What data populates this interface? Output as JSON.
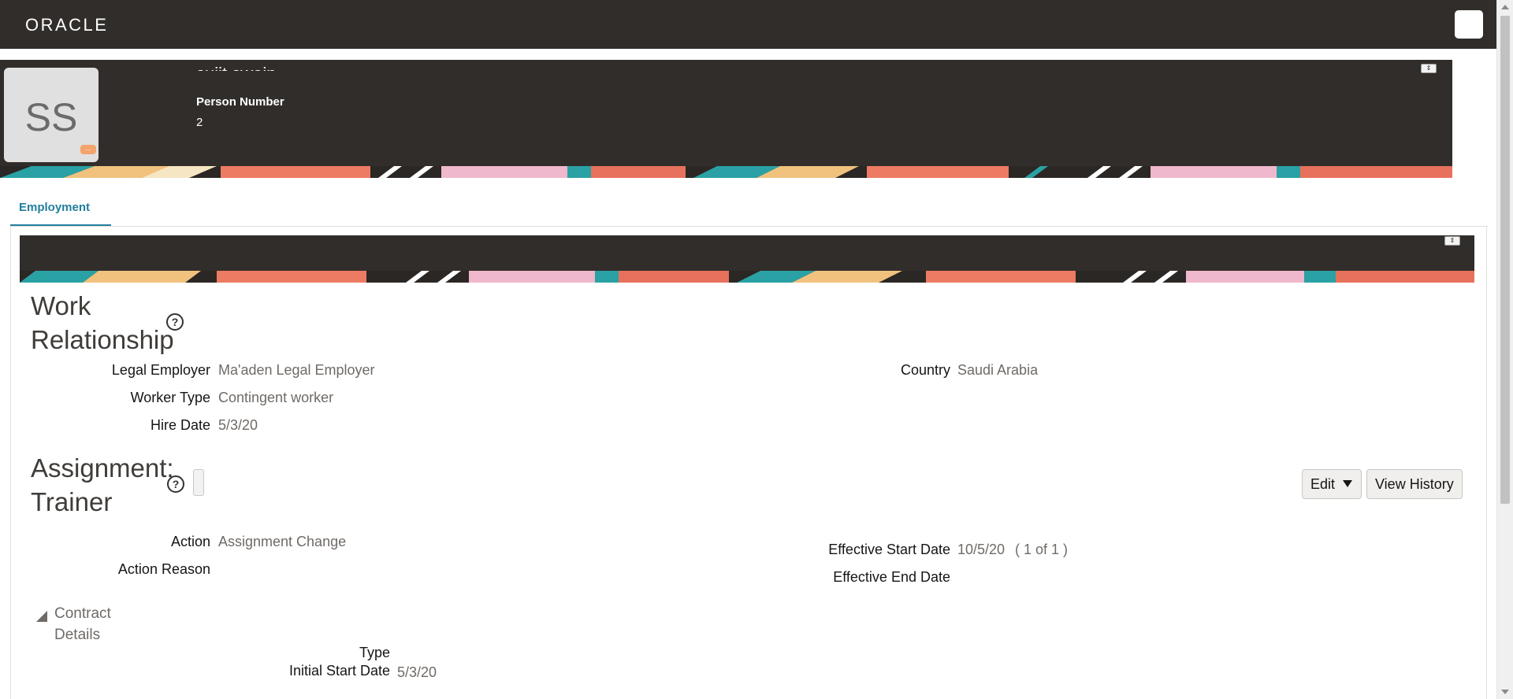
{
  "topbar": {
    "logo": "ORACLE",
    "user_icon": "user-menu-icon"
  },
  "header": {
    "avatar_initials": "SS",
    "avatar_badge": "...",
    "person_name": "sujit swain",
    "person_number_label": "Person Number",
    "person_number_value": "2",
    "collapse_icon": "collapse-icon"
  },
  "tabs": [
    {
      "label": "Employment"
    }
  ],
  "work_relationship": {
    "title": "Work Relationship",
    "title_line1": "Work",
    "title_line2": "Relationship",
    "help": "?",
    "fields": {
      "legal_employer_label": "Legal Employer",
      "legal_employer_value": "Ma'aden Legal Employer",
      "worker_type_label": "Worker Type",
      "worker_type_value": "Contingent worker",
      "hire_date_label": "Hire Date",
      "hire_date_value": "5/3/20",
      "country_label": "Country",
      "country_value": "Saudi Arabia"
    }
  },
  "assignment": {
    "title_line1": "Assignment:",
    "title_line2": "Trainer",
    "help": "?",
    "edit_label": "Edit",
    "view_history_label": "View History",
    "fields": {
      "action_label": "Action",
      "action_value": "Assignment Change",
      "action_reason_label": "Action Reason",
      "action_reason_value": "",
      "effective_start_label": "Effective Start Date",
      "effective_start_value": "10/5/20",
      "record_position": "(   1 of 1   )",
      "effective_end_label": "Effective End Date",
      "effective_end_value": ""
    }
  },
  "contract_details": {
    "title_line1": "Contract",
    "title_line2": "Details",
    "type_label": "Type",
    "type_value": "",
    "initial_start_label": "Initial Start Date",
    "initial_start_value": "5/3/20"
  },
  "colors": {
    "topbar_bg": "#312d2a",
    "tab_accent": "#227e9e",
    "value_text": "#6f6a66"
  }
}
